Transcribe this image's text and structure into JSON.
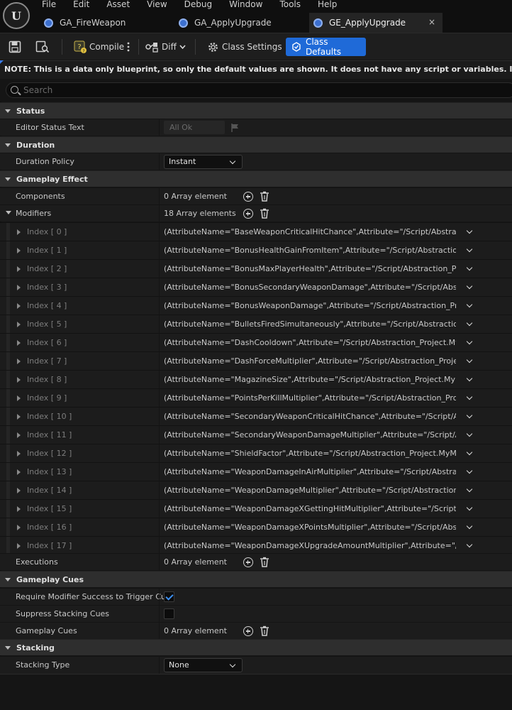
{
  "menu": [
    "File",
    "Edit",
    "Asset",
    "View",
    "Debug",
    "Window",
    "Tools",
    "Help"
  ],
  "tabs": [
    {
      "label": "GA_FireWeapon"
    },
    {
      "label": "GA_ApplyUpgrade"
    },
    {
      "label": "GE_ApplyUpgrade",
      "close": "×"
    }
  ],
  "toolbar": {
    "compile": "Compile",
    "diff": "Diff",
    "class_settings": "Class Settings",
    "class_defaults": "Class Defaults"
  },
  "note": "NOTE: This is a data only blueprint, so only the default values are shown.  It does not have any script or variables.  If you want to add some",
  "search": {
    "placeholder": "Search"
  },
  "sections": {
    "status": {
      "title": "Status",
      "editor_status_label": "Editor Status Text",
      "editor_status_value": "All Ok"
    },
    "duration": {
      "title": "Duration",
      "policy_label": "Duration Policy",
      "policy_value": "Instant"
    },
    "gameplay_effect": {
      "title": "Gameplay Effect",
      "components_label": "Components",
      "components_value": "0 Array element",
      "modifiers_label": "Modifiers",
      "modifiers_value": "18 Array elements",
      "executions_label": "Executions",
      "executions_value": "0 Array element"
    },
    "cues": {
      "title": "Gameplay Cues",
      "require_label": "Require Modifier Success to Trigger Cues",
      "suppress_label": "Suppress Stacking Cues",
      "cues_label": "Gameplay Cues",
      "cues_value": "0 Array element"
    },
    "stacking": {
      "title": "Stacking",
      "type_label": "Stacking Type",
      "type_value": "None"
    }
  },
  "modifiers": [
    {
      "index": "Index [ 0 ]",
      "value": "(AttributeName=\"BaseWeaponCriticalHitChance\",Attribute=\"/Script/Abstraction_Project.MyMainCharacterAttributeSet\")"
    },
    {
      "index": "Index [ 1 ]",
      "value": "(AttributeName=\"BonusHealthGainFromItem\",Attribute=\"/Script/Abstraction_Project.MyMainCharacterAttributeSet\")"
    },
    {
      "index": "Index [ 2 ]",
      "value": "(AttributeName=\"BonusMaxPlayerHealth\",Attribute=\"/Script/Abstraction_Project.MyMainCharacterAttributeSet\")"
    },
    {
      "index": "Index [ 3 ]",
      "value": "(AttributeName=\"BonusSecondaryWeaponDamage\",Attribute=\"/Script/Abstraction_Project.MyMainCharacterAttributeSet\")"
    },
    {
      "index": "Index [ 4 ]",
      "value": "(AttributeName=\"BonusWeaponDamage\",Attribute=\"/Script/Abstraction_Project.MyMainCharacterAttributeSet\")"
    },
    {
      "index": "Index [ 5 ]",
      "value": "(AttributeName=\"BulletsFiredSimultaneously\",Attribute=\"/Script/Abstraction_Project.MyMainCharacterAttributeSet\")"
    },
    {
      "index": "Index [ 6 ]",
      "value": "(AttributeName=\"DashCooldown\",Attribute=\"/Script/Abstraction_Project.MyMainCharacterAttributeSet\")"
    },
    {
      "index": "Index [ 7 ]",
      "value": "(AttributeName=\"DashForceMultiplier\",Attribute=\"/Script/Abstraction_Project.MyMainCharacterAttributeSet\")"
    },
    {
      "index": "Index [ 8 ]",
      "value": "(AttributeName=\"MagazineSize\",Attribute=\"/Script/Abstraction_Project.MyMainCharacterAttributeSet\")"
    },
    {
      "index": "Index [ 9 ]",
      "value": "(AttributeName=\"PointsPerKillMultiplier\",Attribute=\"/Script/Abstraction_Project.MyMainCharacterAttributeSet\")"
    },
    {
      "index": "Index [ 10 ]",
      "value": "(AttributeName=\"SecondaryWeaponCriticalHitChance\",Attribute=\"/Script/Abstraction_Project.MyMainCharacterAttributeSet\")"
    },
    {
      "index": "Index [ 11 ]",
      "value": "(AttributeName=\"SecondaryWeaponDamageMultiplier\",Attribute=\"/Script/Abstraction_Project.MyMainCharacterAttributeSet\")"
    },
    {
      "index": "Index [ 12 ]",
      "value": "(AttributeName=\"ShieldFactor\",Attribute=\"/Script/Abstraction_Project.MyMainCharacterAttributeSet\")"
    },
    {
      "index": "Index [ 13 ]",
      "value": "(AttributeName=\"WeaponDamageInAirMultiplier\",Attribute=\"/Script/Abstraction_Project.MyMainCharacterAttributeSet\")"
    },
    {
      "index": "Index [ 14 ]",
      "value": "(AttributeName=\"WeaponDamageMultiplier\",Attribute=\"/Script/Abstraction_Project.MyMainCharacterAttributeSet\")"
    },
    {
      "index": "Index [ 15 ]",
      "value": "(AttributeName=\"WeaponDamageXGettingHitMultiplier\",Attribute=\"/Script/Abstraction_Project.MyMainCharacterAttributeSet\")"
    },
    {
      "index": "Index [ 16 ]",
      "value": "(AttributeName=\"WeaponDamageXPointsMultiplier\",Attribute=\"/Script/Abstraction_Project.MyMainCharacterAttributeSet\")"
    },
    {
      "index": "Index [ 17 ]",
      "value": "(AttributeName=\"WeaponDamageXUpgradeAmountMultiplier\",Attribute=\"/Script/Abstraction_Project.MyMainCharacterAttributeSet\")"
    }
  ],
  "colors": {
    "accent": "#1f6ad8",
    "check": "#3c8ff0",
    "section_bg": "#2e2e2e",
    "row_bg": "#1c1c1c"
  }
}
